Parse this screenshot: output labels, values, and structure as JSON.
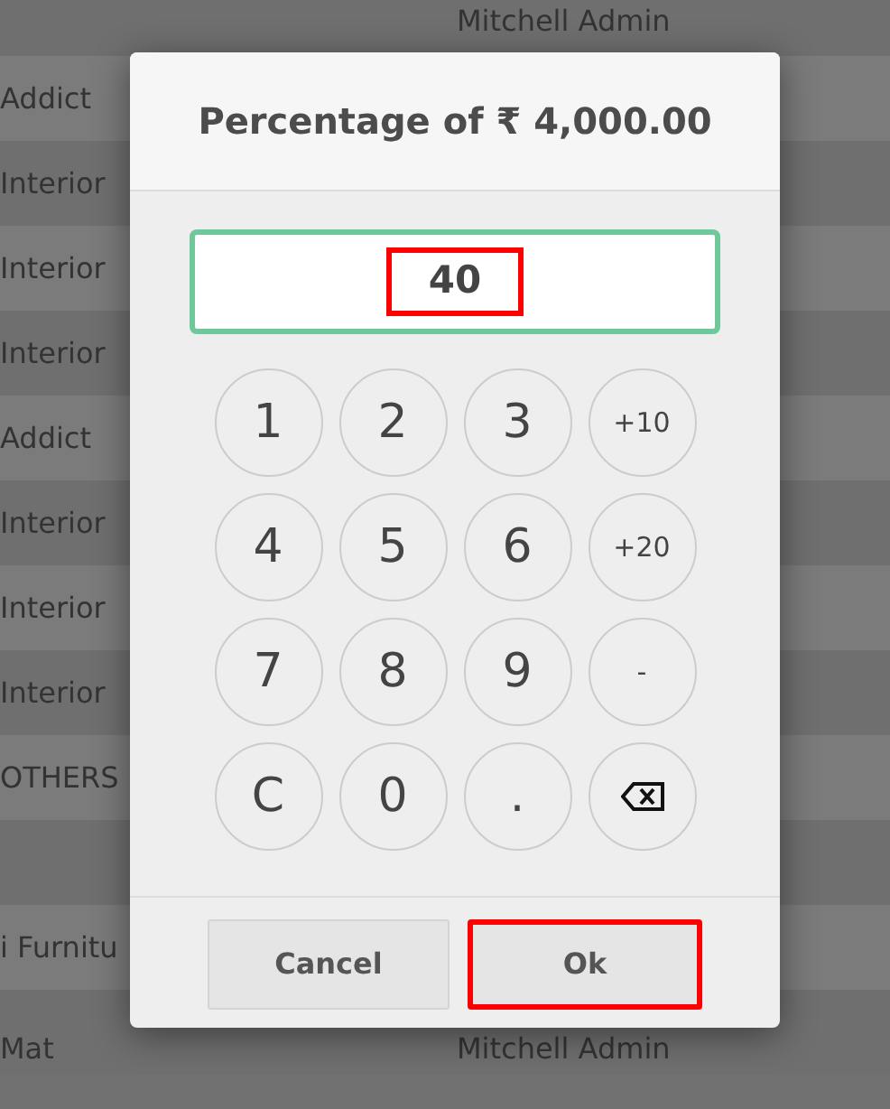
{
  "background_table": {
    "rows": [
      {
        "column_1": "",
        "column_2": "Mitchell Admin"
      },
      {
        "column_1": "Addict",
        "column_2": ""
      },
      {
        "column_1": "Interior",
        "column_2": ""
      },
      {
        "column_1": "Interior",
        "column_2": ""
      },
      {
        "column_1": "Interior",
        "column_2": ""
      },
      {
        "column_1": "Addict",
        "column_2": ""
      },
      {
        "column_1": "Interior",
        "column_2": ""
      },
      {
        "column_1": "Interior",
        "column_2": ""
      },
      {
        "column_1": "Interior",
        "column_2": ""
      },
      {
        "column_1": "OTHERS",
        "column_2": ""
      },
      {
        "column_1": "",
        "column_2": ""
      },
      {
        "column_1": "i Furnitu",
        "column_2": ""
      },
      {
        "column_1": "Mat",
        "column_2": "Mitchell Admin"
      }
    ]
  },
  "dialog": {
    "title": "Percentage of ₹ 4,000.00",
    "input": {
      "value": "40",
      "highlighted": true
    },
    "keys": [
      {
        "kind": "digit",
        "label": "1"
      },
      {
        "kind": "digit",
        "label": "2"
      },
      {
        "kind": "digit",
        "label": "3"
      },
      {
        "kind": "small",
        "label": "+10"
      },
      {
        "kind": "digit",
        "label": "4"
      },
      {
        "kind": "digit",
        "label": "5"
      },
      {
        "kind": "digit",
        "label": "6"
      },
      {
        "kind": "small",
        "label": "+20"
      },
      {
        "kind": "digit",
        "label": "7"
      },
      {
        "kind": "digit",
        "label": "8"
      },
      {
        "kind": "digit",
        "label": "9"
      },
      {
        "kind": "small",
        "label": "-"
      },
      {
        "kind": "digit",
        "label": "C"
      },
      {
        "kind": "digit",
        "label": "0"
      },
      {
        "kind": "digit",
        "label": "."
      },
      {
        "kind": "backspace"
      }
    ],
    "buttons": [
      {
        "label": "Cancel",
        "highlighted": false
      },
      {
        "label": "Ok",
        "highlighted": true
      }
    ]
  }
}
